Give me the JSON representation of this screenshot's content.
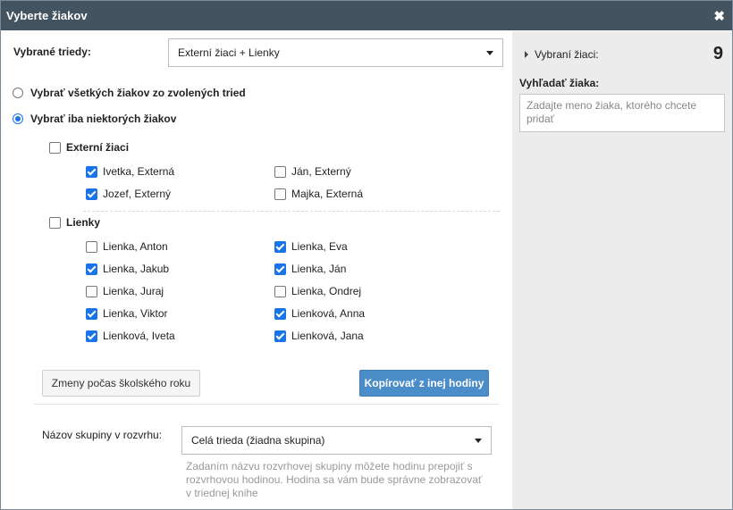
{
  "dialog": {
    "title": "Vyberte žiakov"
  },
  "classes": {
    "label": "Vybrané triedy:",
    "selected": "Externí žiaci + Lienky"
  },
  "mode": {
    "all_label": "Vybrať všetkých žiakov zo zvolených tried",
    "some_label": "Vybrať iba niektorých žiakov",
    "selected": "some"
  },
  "groups": [
    {
      "name": "Externí žiaci",
      "checked": false,
      "students": [
        {
          "name": "Ivetka, Externá",
          "checked": true
        },
        {
          "name": "Ján, Externý",
          "checked": false
        },
        {
          "name": "Jozef, Externý",
          "checked": true
        },
        {
          "name": "Majka, Externá",
          "checked": false
        }
      ]
    },
    {
      "name": "Lienky",
      "checked": false,
      "students": [
        {
          "name": "Lienka, Anton",
          "checked": false
        },
        {
          "name": "Lienka, Eva",
          "checked": true
        },
        {
          "name": "Lienka, Jakub",
          "checked": true
        },
        {
          "name": "Lienka, Ján",
          "checked": true
        },
        {
          "name": "Lienka, Juraj",
          "checked": false
        },
        {
          "name": "Lienka, Ondrej",
          "checked": false
        },
        {
          "name": "Lienka, Viktor",
          "checked": true
        },
        {
          "name": "Lienková, Anna",
          "checked": true
        },
        {
          "name": "Lienková, Iveta",
          "checked": true
        },
        {
          "name": "Lienková, Jana",
          "checked": true
        }
      ]
    }
  ],
  "buttons": {
    "changes_label": "Zmeny počas školského roku",
    "copy_label": "Kopírovať z inej hodiny"
  },
  "schedule_group": {
    "label": "Názov skupiny v rozvrhu:",
    "selected": "Celá trieda (žiadna skupina)",
    "help": "Zadaním názvu rozvrhovej skupiny môžete hodinu prepojiť s rozvrhovou hodinou. Hodina sa vám bude správne zobrazovať v triednej knihe"
  },
  "side": {
    "selected_label": "Vybraní žiaci:",
    "selected_count": "9",
    "search_label": "Vyhľadať žiaka:",
    "search_placeholder": "Zadajte meno žiaka, ktorého chcete pridať"
  },
  "colors": {
    "titlebar": "#445360",
    "accent": "#1a73e8",
    "primary_button": "#4b8dc8",
    "side_bg": "#ececec"
  }
}
